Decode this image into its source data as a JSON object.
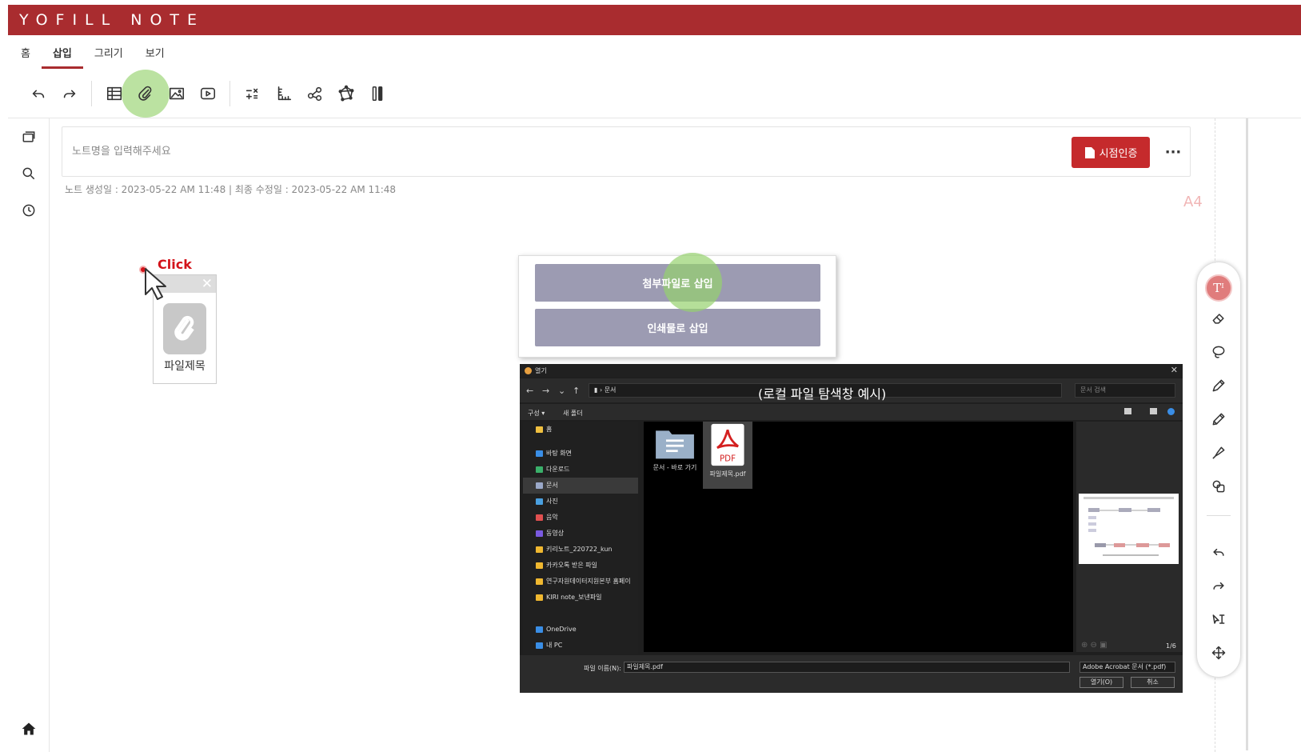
{
  "app": {
    "title": "YOFILL NOTE",
    "brand_color": "#a92c2f"
  },
  "tabs": [
    {
      "label": "홈"
    },
    {
      "label": "삽입",
      "active": true
    },
    {
      "label": "그리기"
    },
    {
      "label": "보기"
    }
  ],
  "toolbar": {
    "icons": [
      "undo-icon",
      "redo-icon",
      "table-icon",
      "attach-icon",
      "image-icon",
      "video-icon",
      "formula-icon",
      "ruler-icon",
      "share-node-icon",
      "graph-icon",
      "test-tube-icon"
    ],
    "highlighted": "attach-icon"
  },
  "sidebar": {
    "icons": [
      "pages-icon",
      "search-icon",
      "history-icon",
      "home-icon"
    ]
  },
  "note": {
    "title_placeholder": "노트명을 입력해주세요",
    "cert_button": "시점인증",
    "more": "···",
    "meta": "노트 생성일 : 2023-05-22 AM 11:48   |   최종 수정일 : 2023-05-22 AM 11:48",
    "page_size": "A4"
  },
  "annotation": {
    "click_label": "Click"
  },
  "file_widget": {
    "close": "✕",
    "name": "파일제목"
  },
  "insert_popup": {
    "attach_button": "첨부파일로 삽입",
    "print_button": "인쇄물로 삽입"
  },
  "explorer": {
    "title": "열기",
    "caption": "(로컬 파일 탐색창 예시)",
    "address": "문서",
    "search_placeholder": "문서 검색",
    "cmd_organize": "구성 ▾",
    "cmd_new_folder": "새 폴더",
    "nav": [
      {
        "label": "홈",
        "color": "#f0c040"
      },
      {
        "label": "바탕 화면",
        "color": "#3a8ee6"
      },
      {
        "label": "다운로드",
        "color": "#3ab06a"
      },
      {
        "label": "문서",
        "color": "#9aa8c8",
        "selected": true
      },
      {
        "label": "사진",
        "color": "#4aa0e0"
      },
      {
        "label": "음악",
        "color": "#e05050"
      },
      {
        "label": "동영상",
        "color": "#7a5ae0"
      },
      {
        "label": "키리노트_220722_kun",
        "color": "#f0b830"
      },
      {
        "label": "카카오톡 받은 파일",
        "color": "#f0b830"
      },
      {
        "label": "연구자원데이터지원본부 홈페이",
        "color": "#f0b830"
      },
      {
        "label": "KIRI note_보낸파일",
        "color": "#f0b830"
      },
      {
        "label": "OneDrive",
        "color": "#3a8ee6"
      },
      {
        "label": "내 PC",
        "color": "#3a8ee6"
      }
    ],
    "files": [
      {
        "label": "문서 - 바로 가기"
      },
      {
        "label": "파일제목.pdf",
        "badge": "PDF",
        "selected": true
      }
    ],
    "preview_pages": "1/6",
    "filename_label": "파일 이름(N):",
    "filename_value": "파일제목.pdf",
    "filetype_value": "Adobe Acrobat 문서 (*.pdf)",
    "open_button": "열기(O)",
    "cancel_button": "취소"
  },
  "right_panel": {
    "icons": [
      "text-tool-icon",
      "eraser-icon",
      "lasso-icon",
      "pen-icon",
      "pencil-icon",
      "highlighter-icon",
      "shapes-icon",
      "undo-icon",
      "redo-icon",
      "text-select-icon",
      "move-icon"
    ],
    "active_glyph": "Tᴵ"
  }
}
